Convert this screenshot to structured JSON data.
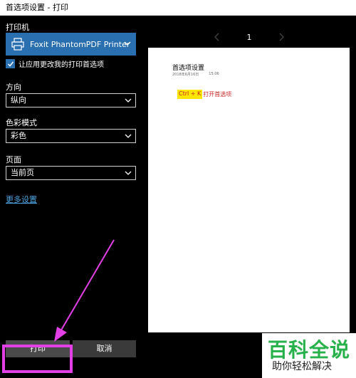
{
  "window": {
    "title": "首选项设置 - 打印"
  },
  "printer": {
    "label": "打印机",
    "selected": "Foxit PhantomPDF Printer",
    "icon": "printer-icon"
  },
  "checkbox": {
    "label": "让应用更改我的打印首选项",
    "checked": true
  },
  "orientation": {
    "label": "方向",
    "value": "纵向"
  },
  "color_mode": {
    "label": "色彩模式",
    "value": "彩色"
  },
  "pages": {
    "label": "页面",
    "value": "当前页"
  },
  "more_settings": "更多设置",
  "buttons": {
    "print": "打印",
    "cancel": "取消"
  },
  "pager": {
    "current": "1"
  },
  "preview": {
    "title": "首选项设置",
    "date": "2018年6月16日",
    "time": "15:06",
    "shortcut": "Ctrl + K",
    "shortcut_desc": "打开首选项"
  },
  "watermark": {
    "brand": "百科全说",
    "tagline": "助你轻松解决"
  },
  "colors": {
    "accent": "#2a6fb0",
    "highlight": "#e33fe6",
    "link": "#4aa3df"
  }
}
